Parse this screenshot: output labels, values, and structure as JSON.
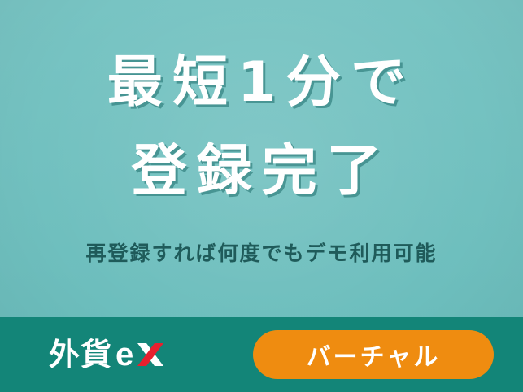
{
  "hero": {
    "headline_line1": "最短1分で",
    "headline_line2": "登録完了",
    "subline": "再登録すれば何度でもデモ利用可能"
  },
  "footer": {
    "logo_kanji": "外貨",
    "logo_latin": "ex",
    "badge_label": "バーチャル"
  },
  "colors": {
    "background": "#74c2c1",
    "footer": "#138578",
    "badge": "#ef8c10",
    "logo_x": "#e8202e",
    "subline": "#1f5b5a"
  }
}
